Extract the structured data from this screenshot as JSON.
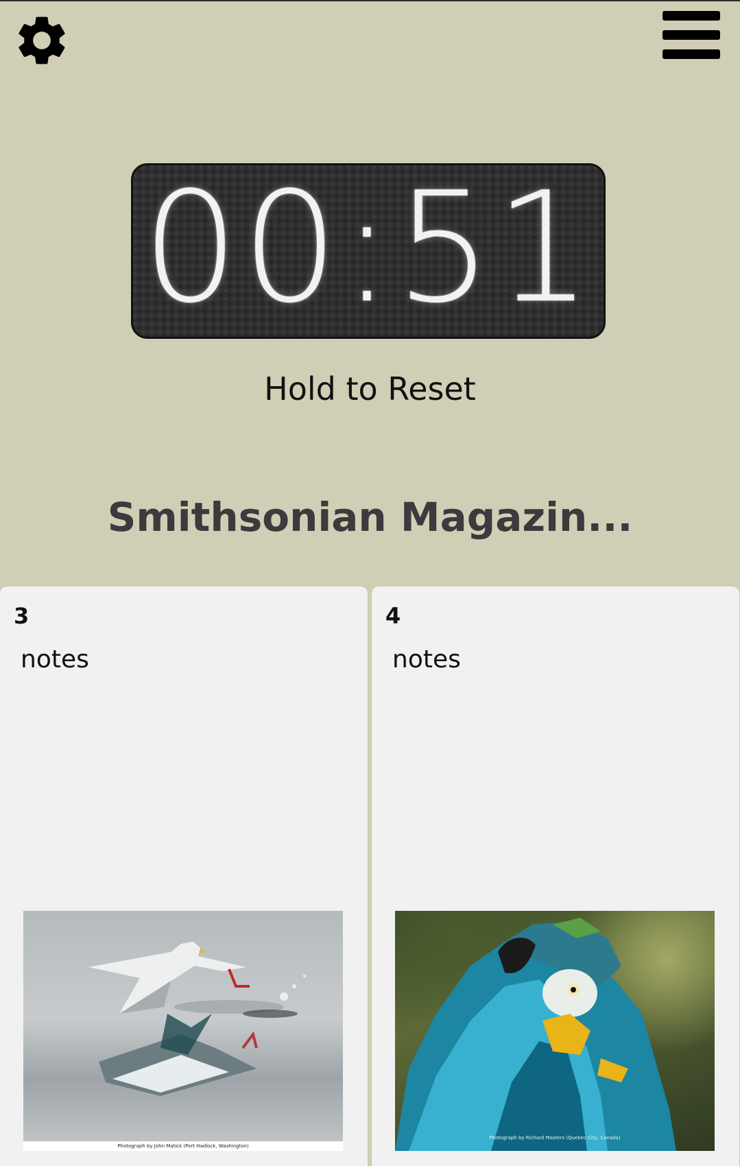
{
  "header": {
    "settings_icon": "gear-icon",
    "menu_icon": "hamburger-menu-icon"
  },
  "timer": {
    "display": "00:51",
    "hint": "Hold to Reset"
  },
  "title": "Smithsonian Magazin...",
  "cards": [
    {
      "number": "3",
      "label": "notes",
      "image_caption": "Photograph by John Matick (Port Hadlock, Washington)"
    },
    {
      "number": "4",
      "label": "notes",
      "image_caption": "Photograph by Richard Masters (Quebec City, Canada)"
    }
  ],
  "colors": {
    "background": "#d0cfb6",
    "card": "#f1f1f1",
    "timer_bg": "#2f2f2f",
    "title": "#3c3a3c"
  }
}
